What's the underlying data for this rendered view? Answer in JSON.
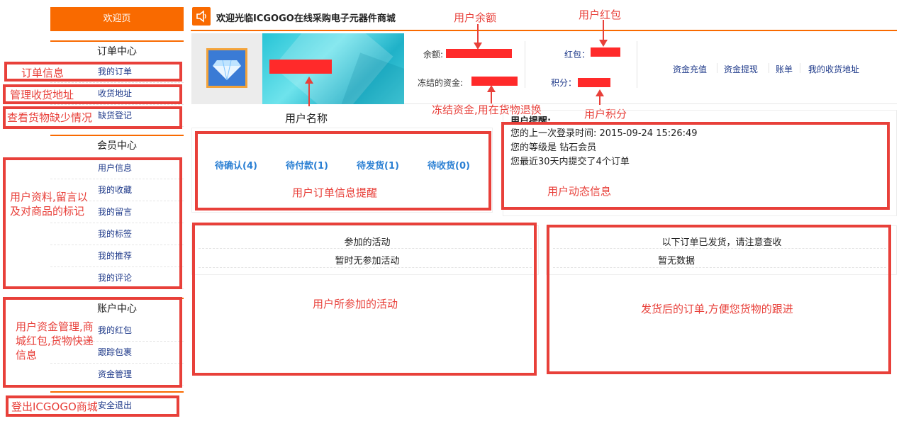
{
  "sidebar": {
    "welcome": "欢迎页",
    "order_center": {
      "title": "订单中心",
      "items": [
        "我的订单",
        "收货地址",
        "缺货登记"
      ]
    },
    "member_center": {
      "title": "会员中心",
      "items": [
        "用户信息",
        "我的收藏",
        "我的留言",
        "我的标签",
        "我的推荐",
        "我的评论"
      ]
    },
    "account_center": {
      "title": "账户中心",
      "items": [
        "我的红包",
        "跟踪包裹",
        "资金管理"
      ]
    },
    "logout": "安全退出"
  },
  "topbar": {
    "welcome": "欢迎光临ICGOGO在线采购电子元器件商城"
  },
  "profile": {
    "balance_label": "余额:",
    "frozen_label": "冻结的资金:",
    "redpacket_label": "红包：",
    "points_label": "积分：",
    "links": [
      "资金充值",
      "资金提现",
      "账单",
      "我的收货地址"
    ]
  },
  "orders": {
    "tabs": [
      "待确认(4)",
      "待付款(1)",
      "待发货(1)",
      "待收货(0)"
    ]
  },
  "reminder": {
    "title": "用户提醒:",
    "lines": [
      "您的上一次登录时间: 2015-09-24 15:26:49",
      "您的等级是 钻石会员",
      "您最近30天内提交了4个订单"
    ]
  },
  "activities": {
    "title": "参加的活动",
    "empty": "暂时无参加活动"
  },
  "shipped": {
    "title": "以下订单已发货，请注意查收",
    "empty": "暂无数据"
  },
  "annotations": {
    "order_info": "订单信息",
    "address": "管理收货地址",
    "shortage": "查看货物缺少情况",
    "member": "用户资料,留言以及对商品的标记",
    "account": "用户资金管理,商城红包,货物快递信息",
    "logout": "登出ICGOGO商城",
    "balance": "用户余额",
    "redpacket": "用户红包",
    "username": "用户名称",
    "frozen": "冻结资金,用在货物退换",
    "points": "用户积分",
    "order_remind": "用户订单信息提醒",
    "dynamic": "用户动态信息",
    "activities": "用户所参加的活动",
    "shipped": "发货后的订单,方便您货物的跟进"
  },
  "colors": {
    "accent": "#f96a00",
    "annotation": "#e8403a",
    "link": "#1f3a8a",
    "order_link": "#2a7fd3"
  }
}
